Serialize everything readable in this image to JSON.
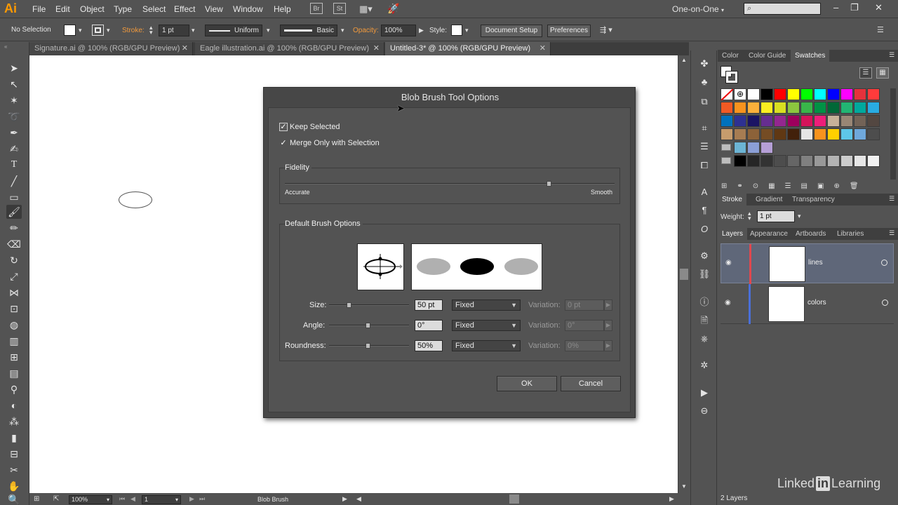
{
  "app": {
    "logo": "Ai",
    "menu": [
      "File",
      "Edit",
      "Object",
      "Type",
      "Select",
      "Effect",
      "View",
      "Window",
      "Help"
    ],
    "bridge_icon": "Br",
    "stock_icon": "St",
    "workspace": "One-on-One",
    "window_controls": [
      "–",
      "❐",
      "✕"
    ]
  },
  "control_bar": {
    "selection_status": "No Selection",
    "stroke_label": "Stroke:",
    "stroke_weight": "1 pt",
    "profile": "Uniform",
    "brush": "Basic",
    "opacity_label": "Opacity:",
    "opacity_value": "100%",
    "style_label": "Style:",
    "document_setup": "Document Setup",
    "preferences": "Preferences"
  },
  "tabs": [
    {
      "label": "Signature.ai @ 100% (RGB/GPU Preview)",
      "active": false
    },
    {
      "label": "Eagle illustration.ai @ 100% (RGB/GPU Preview)",
      "active": false
    },
    {
      "label": "Untitled-3* @ 100% (RGB/GPU Preview)",
      "active": true
    }
  ],
  "status_bar": {
    "zoom": "100%",
    "artboard_number": "1",
    "current_tool": "Blob Brush"
  },
  "swatches_panel": {
    "tabs": [
      "Color",
      "Color Guide",
      "Swatches"
    ],
    "active_tab": "Swatches",
    "rows": [
      [
        "#ffffff",
        "#ffffff",
        "#ffffff",
        "#000000",
        "#ff0000",
        "#ffff00",
        "#00ff00",
        "#00ffff",
        "#0000ff",
        "#ff00ff",
        "#e5323c",
        "#ff3b3b"
      ],
      [
        "#f15a24",
        "#f7931e",
        "#fbb03b",
        "#fcee21",
        "#d9e021",
        "#8cc63f",
        "#39b54a",
        "#009245",
        "#006837",
        "#22b573",
        "#00a99d",
        "#29abe2"
      ],
      [
        "#0071bc",
        "#2e3192",
        "#1b1464",
        "#662d91",
        "#93278f",
        "#9e005d",
        "#d4145a",
        "#ed1e79",
        "#c7b299",
        "#998675",
        "#736357",
        "#534741"
      ],
      [
        "#c69c6d",
        "#a67c52",
        "#8c6239",
        "#754c24",
        "#603813",
        "#42210b",
        "#e6e6e6",
        "#f7931e",
        "#ffd000",
        "#5ec6e8",
        "#6fa8dc",
        "#4d4d4d"
      ],
      [
        "#6cb4d4",
        "#8b9fd6",
        "#b59fd6"
      ],
      [
        "#000000",
        "#262626",
        "#333333",
        "#4d4d4d",
        "#666666",
        "#808080",
        "#999999",
        "#b3b3b3",
        "#cccccc",
        "#e6e6e6",
        "#f2f2f2"
      ]
    ]
  },
  "stroke_panel": {
    "tabs": [
      "Stroke",
      "Gradient",
      "Transparency"
    ],
    "weight_label": "Weight:",
    "weight_value": "1 pt"
  },
  "layers_panel": {
    "tabs": [
      "Layers",
      "Appearance",
      "Artboards",
      "Libraries"
    ],
    "layers": [
      {
        "name": "lines",
        "color": "#e0484e",
        "selected": true
      },
      {
        "name": "colors",
        "color": "#4a6fd9",
        "selected": false
      }
    ],
    "count": "2 Layers"
  },
  "dialog": {
    "title": "Blob Brush Tool Options",
    "keep_selected": "Keep Selected",
    "merge_only": "Merge Only with Selection",
    "fidelity_title": "Fidelity",
    "fidelity_left": "Accurate",
    "fidelity_right": "Smooth",
    "fidelity_level": 0.8,
    "brush_options_title": "Default Brush Options",
    "rows": [
      {
        "label": "Size:",
        "value": "50 pt",
        "mode": "Fixed",
        "variation_label": "Variation:",
        "variation": "0 pt"
      },
      {
        "label": "Angle:",
        "value": "0°",
        "mode": "Fixed",
        "variation_label": "Variation:",
        "variation": "0°"
      },
      {
        "label": "Roundness:",
        "value": "50%",
        "mode": "Fixed",
        "variation_label": "Variation:",
        "variation": "0%"
      }
    ],
    "ok": "OK",
    "cancel": "Cancel"
  },
  "watermark": "Linked",
  "watermark_in": "in",
  "watermark_rest": "Learning"
}
